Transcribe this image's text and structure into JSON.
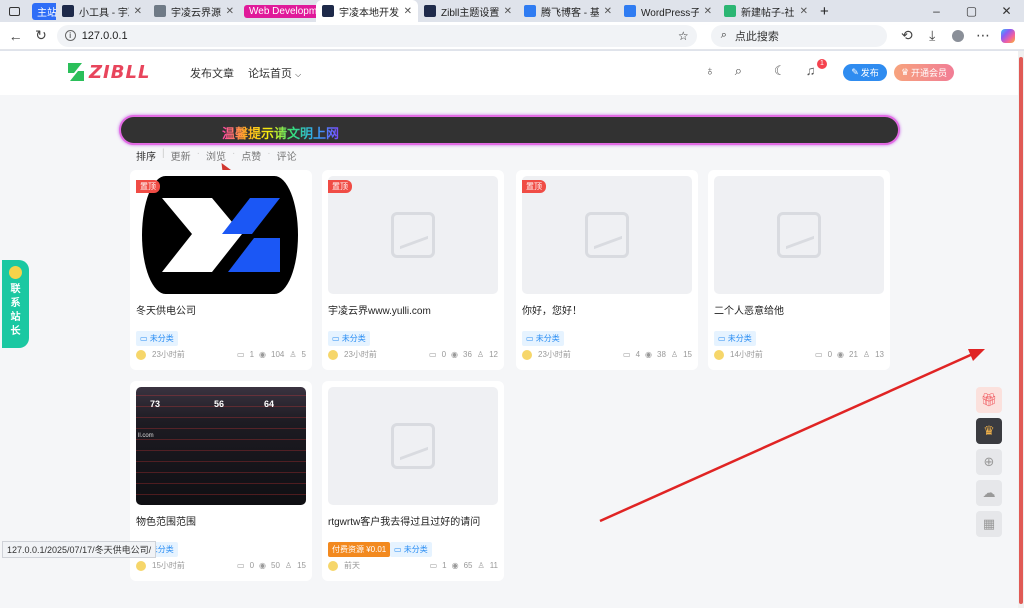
{
  "browser": {
    "tabs": [
      {
        "label": "主站",
        "group": true,
        "color": "#2f6ef7"
      },
      {
        "label": "小工具 - 宇凌云界",
        "color": "#1e2a4a",
        "x": true
      },
      {
        "label": "宇凌云界源码网",
        "color": "#6f7a86",
        "x": true
      },
      {
        "label": "Web Development",
        "group": true,
        "color": "#e01a9a"
      },
      {
        "label": "宇凌本地开发网站",
        "color": "#1e2a4a",
        "active": true,
        "x": true
      },
      {
        "label": "Zibll主题设置 - 宇",
        "color": "#1e2a4a",
        "x": true
      },
      {
        "label": "腾飞博客 - 基于新",
        "color": "#2f7cf2",
        "x": true
      },
      {
        "label": "WordPress子比种",
        "color": "#2f7cf2",
        "x": true
      },
      {
        "label": "新建帖子-社区-W",
        "color": "#2bb673",
        "x": true
      }
    ],
    "url": "127.0.0.1",
    "search_placeholder": "点此搜索",
    "status_url": "127.0.0.1/2025/07/17/冬天供电公司/"
  },
  "site": {
    "logo_text": "ZIBLL",
    "nav": [
      "发布文章",
      "论坛首页"
    ],
    "publish_label": "发布",
    "vip_label": "开通会员",
    "notification_count": "1",
    "notice_text": "温馨提示请文明上网",
    "sort": [
      "排序",
      "更新",
      "浏览",
      "点赞",
      "评论"
    ],
    "left_tab": "联系站长"
  },
  "cards": [
    {
      "title": "冬天供电公司",
      "top": "置顶",
      "cat": "未分类",
      "time": "23小时前",
      "comments": "1",
      "views": "104",
      "likes": "5",
      "thumb": "logo"
    },
    {
      "title": "宇凌云界www.yulli.com",
      "top": "置顶",
      "cat": "未分类",
      "time": "23小时前",
      "comments": "0",
      "views": "36",
      "likes": "12",
      "thumb": "placeholder"
    },
    {
      "title": "你好，您好！",
      "top": "置顶",
      "cat": "未分类",
      "time": "23小时前",
      "comments": "4",
      "views": "38",
      "likes": "15",
      "thumb": "placeholder"
    },
    {
      "title": "二个人恶意给他",
      "cat": "未分类",
      "time": "14小时前",
      "comments": "0",
      "views": "21",
      "likes": "13",
      "thumb": "placeholder"
    },
    {
      "title": "物色范围范围",
      "cat": "未分类",
      "time": "15小时前",
      "comments": "0",
      "views": "50",
      "likes": "15",
      "thumb": "dark"
    },
    {
      "title": "rtgwrtw客户我去得过且过好的请问",
      "paid": "付费资源 ¥0.01",
      "cat": "未分类",
      "time": "前天",
      "comments": "1",
      "views": "65",
      "likes": "11",
      "thumb": "placeholder"
    }
  ]
}
